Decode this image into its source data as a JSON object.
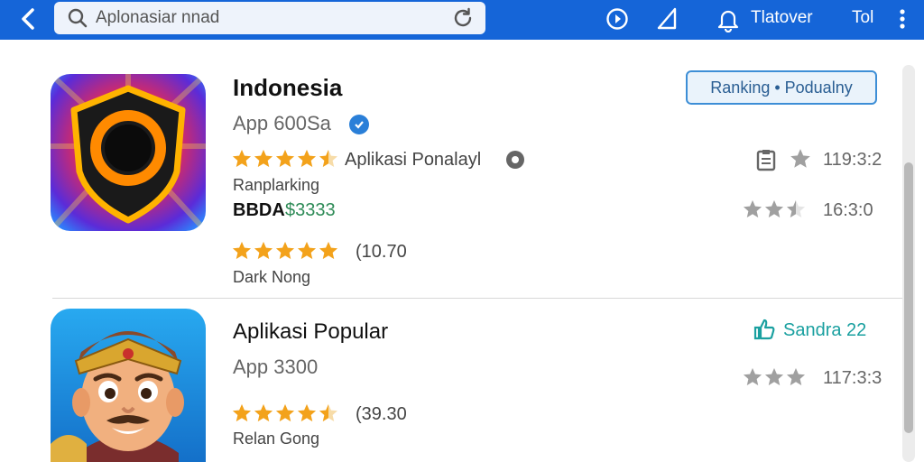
{
  "topbar": {
    "search_value": "Aplonasiar nnad",
    "account_label": "Tlatover",
    "extra_label": "Tol",
    "bg_color": "#1565d8"
  },
  "list": [
    {
      "name": "Indonesia",
      "id_label": "App 600Sa",
      "rating_stars": 4.5,
      "category": "Aplikasi Ponalayl",
      "tagline": "Ranplarking",
      "price_prefix": "BBDA",
      "price": "$3333",
      "rating2_stars": 5,
      "rating2_count": "(10.70",
      "developer": "Dark Nong",
      "rank_button": "Ranking • Podualny",
      "meta1": "119:3:2",
      "meta2": "16:3:0",
      "meta2_stars": 2.5
    },
    {
      "name": "Aplikasi Popular",
      "id_label": "App 3300",
      "rating_stars": 4.5,
      "rating_count": "(39.30",
      "developer": "Relan Gong",
      "like_label": "Sandra 22",
      "meta1": "117:3:3",
      "meta1_stars": 3
    }
  ],
  "colors": {
    "star": "#f3a21b",
    "star_grey": "#a0a0a0",
    "price_green": "#2e8b57",
    "like_teal": "#1aa0a0"
  }
}
